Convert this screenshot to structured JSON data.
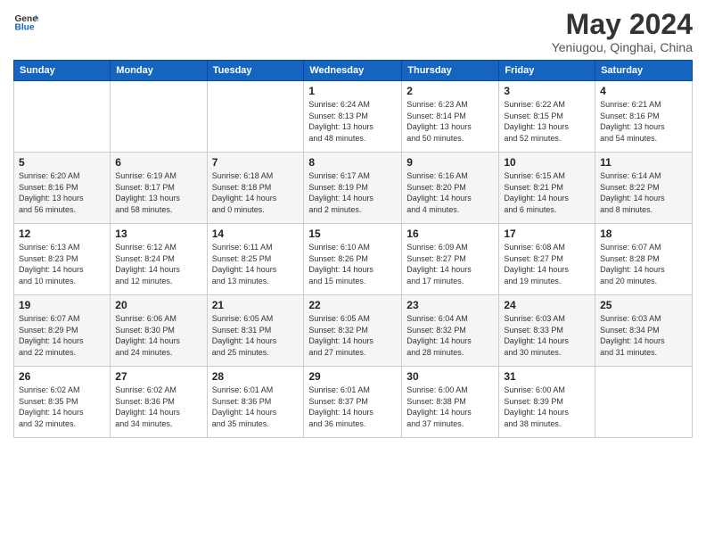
{
  "header": {
    "logo_line1": "General",
    "logo_line2": "Blue",
    "month_title": "May 2024",
    "subtitle": "Yeniugou, Qinghai, China"
  },
  "weekdays": [
    "Sunday",
    "Monday",
    "Tuesday",
    "Wednesday",
    "Thursday",
    "Friday",
    "Saturday"
  ],
  "weeks": [
    [
      {
        "day": "",
        "info": ""
      },
      {
        "day": "",
        "info": ""
      },
      {
        "day": "",
        "info": ""
      },
      {
        "day": "1",
        "info": "Sunrise: 6:24 AM\nSunset: 8:13 PM\nDaylight: 13 hours\nand 48 minutes."
      },
      {
        "day": "2",
        "info": "Sunrise: 6:23 AM\nSunset: 8:14 PM\nDaylight: 13 hours\nand 50 minutes."
      },
      {
        "day": "3",
        "info": "Sunrise: 6:22 AM\nSunset: 8:15 PM\nDaylight: 13 hours\nand 52 minutes."
      },
      {
        "day": "4",
        "info": "Sunrise: 6:21 AM\nSunset: 8:16 PM\nDaylight: 13 hours\nand 54 minutes."
      }
    ],
    [
      {
        "day": "5",
        "info": "Sunrise: 6:20 AM\nSunset: 8:16 PM\nDaylight: 13 hours\nand 56 minutes."
      },
      {
        "day": "6",
        "info": "Sunrise: 6:19 AM\nSunset: 8:17 PM\nDaylight: 13 hours\nand 58 minutes."
      },
      {
        "day": "7",
        "info": "Sunrise: 6:18 AM\nSunset: 8:18 PM\nDaylight: 14 hours\nand 0 minutes."
      },
      {
        "day": "8",
        "info": "Sunrise: 6:17 AM\nSunset: 8:19 PM\nDaylight: 14 hours\nand 2 minutes."
      },
      {
        "day": "9",
        "info": "Sunrise: 6:16 AM\nSunset: 8:20 PM\nDaylight: 14 hours\nand 4 minutes."
      },
      {
        "day": "10",
        "info": "Sunrise: 6:15 AM\nSunset: 8:21 PM\nDaylight: 14 hours\nand 6 minutes."
      },
      {
        "day": "11",
        "info": "Sunrise: 6:14 AM\nSunset: 8:22 PM\nDaylight: 14 hours\nand 8 minutes."
      }
    ],
    [
      {
        "day": "12",
        "info": "Sunrise: 6:13 AM\nSunset: 8:23 PM\nDaylight: 14 hours\nand 10 minutes."
      },
      {
        "day": "13",
        "info": "Sunrise: 6:12 AM\nSunset: 8:24 PM\nDaylight: 14 hours\nand 12 minutes."
      },
      {
        "day": "14",
        "info": "Sunrise: 6:11 AM\nSunset: 8:25 PM\nDaylight: 14 hours\nand 13 minutes."
      },
      {
        "day": "15",
        "info": "Sunrise: 6:10 AM\nSunset: 8:26 PM\nDaylight: 14 hours\nand 15 minutes."
      },
      {
        "day": "16",
        "info": "Sunrise: 6:09 AM\nSunset: 8:27 PM\nDaylight: 14 hours\nand 17 minutes."
      },
      {
        "day": "17",
        "info": "Sunrise: 6:08 AM\nSunset: 8:27 PM\nDaylight: 14 hours\nand 19 minutes."
      },
      {
        "day": "18",
        "info": "Sunrise: 6:07 AM\nSunset: 8:28 PM\nDaylight: 14 hours\nand 20 minutes."
      }
    ],
    [
      {
        "day": "19",
        "info": "Sunrise: 6:07 AM\nSunset: 8:29 PM\nDaylight: 14 hours\nand 22 minutes."
      },
      {
        "day": "20",
        "info": "Sunrise: 6:06 AM\nSunset: 8:30 PM\nDaylight: 14 hours\nand 24 minutes."
      },
      {
        "day": "21",
        "info": "Sunrise: 6:05 AM\nSunset: 8:31 PM\nDaylight: 14 hours\nand 25 minutes."
      },
      {
        "day": "22",
        "info": "Sunrise: 6:05 AM\nSunset: 8:32 PM\nDaylight: 14 hours\nand 27 minutes."
      },
      {
        "day": "23",
        "info": "Sunrise: 6:04 AM\nSunset: 8:32 PM\nDaylight: 14 hours\nand 28 minutes."
      },
      {
        "day": "24",
        "info": "Sunrise: 6:03 AM\nSunset: 8:33 PM\nDaylight: 14 hours\nand 30 minutes."
      },
      {
        "day": "25",
        "info": "Sunrise: 6:03 AM\nSunset: 8:34 PM\nDaylight: 14 hours\nand 31 minutes."
      }
    ],
    [
      {
        "day": "26",
        "info": "Sunrise: 6:02 AM\nSunset: 8:35 PM\nDaylight: 14 hours\nand 32 minutes."
      },
      {
        "day": "27",
        "info": "Sunrise: 6:02 AM\nSunset: 8:36 PM\nDaylight: 14 hours\nand 34 minutes."
      },
      {
        "day": "28",
        "info": "Sunrise: 6:01 AM\nSunset: 8:36 PM\nDaylight: 14 hours\nand 35 minutes."
      },
      {
        "day": "29",
        "info": "Sunrise: 6:01 AM\nSunset: 8:37 PM\nDaylight: 14 hours\nand 36 minutes."
      },
      {
        "day": "30",
        "info": "Sunrise: 6:00 AM\nSunset: 8:38 PM\nDaylight: 14 hours\nand 37 minutes."
      },
      {
        "day": "31",
        "info": "Sunrise: 6:00 AM\nSunset: 8:39 PM\nDaylight: 14 hours\nand 38 minutes."
      },
      {
        "day": "",
        "info": ""
      }
    ]
  ]
}
